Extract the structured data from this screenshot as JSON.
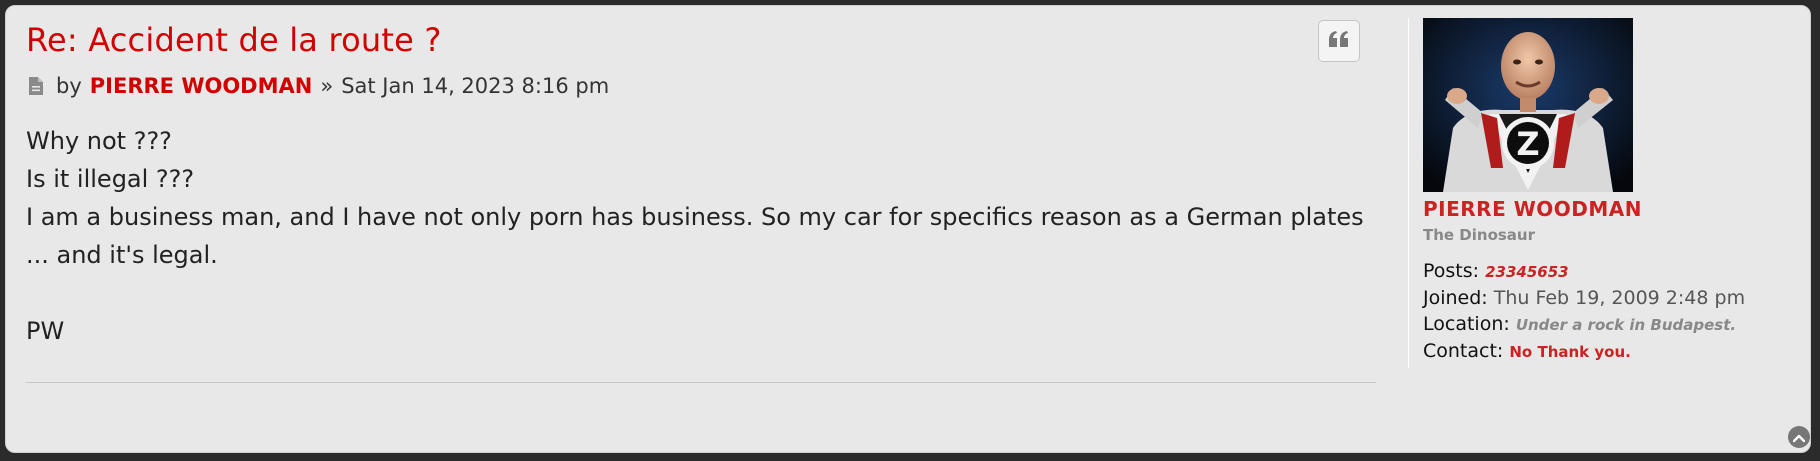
{
  "post": {
    "title": "Re: Accident de la route ?",
    "meta": {
      "by_label": "by",
      "author": "PIERRE WOODMAN",
      "separator": "»",
      "date": "Sat Jan 14, 2023 8:16 pm"
    },
    "content": {
      "line1": "Why not ???",
      "line2": "Is it illegal ???",
      "line3": "I am a business man, and I have not only porn has business. So my car for specifics reason as a German plates",
      "line4": "... and it's legal.",
      "line5": "PW"
    }
  },
  "profile": {
    "username": "PIERRE WOODMAN",
    "rank": "The Dinosaur",
    "posts_label": "Posts:",
    "posts_value": "23345653",
    "joined_label": "Joined:",
    "joined_value": "Thu Feb 19, 2009 2:48 pm",
    "location_label": "Location:",
    "location_value": "Under a rock in Budapest.",
    "contact_label": "Contact:",
    "contact_value": "No Thank you.",
    "avatar_letter": "Z"
  },
  "icons": {
    "post": "post-file-icon",
    "quote": "quote-icon",
    "top": "back-to-top-icon"
  },
  "colors": {
    "accent_red": "#d30000",
    "panel_bg": "#e8e8e8",
    "page_bg": "#2b2b2b"
  }
}
